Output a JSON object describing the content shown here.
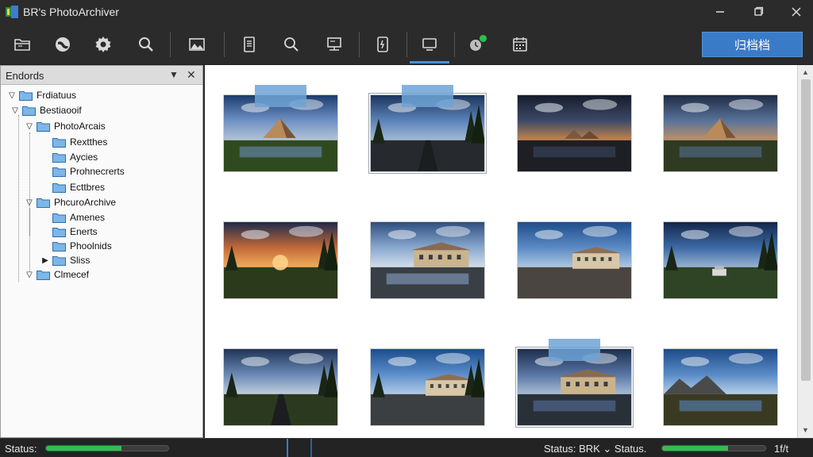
{
  "window": {
    "title": "BR's PhotoArchiver",
    "logo_icon": "photoarchiver-logo-icon",
    "minimize_icon": "minimize-icon",
    "maximize_icon": "maximize-icon",
    "close_icon": "close-icon"
  },
  "toolbar": {
    "buttons": [
      {
        "icon": "open-folder-icon"
      },
      {
        "icon": "globe-icon"
      },
      {
        "icon": "gear-icon"
      },
      {
        "icon": "search-icon"
      },
      {
        "icon": "image-icon"
      },
      {
        "icon": "document-icon"
      },
      {
        "icon": "zoom-icon"
      },
      {
        "icon": "slideshow-icon"
      },
      {
        "icon": "export-icon"
      },
      {
        "icon": "monitor-icon"
      },
      {
        "icon": "sync-status-icon"
      },
      {
        "icon": "calendar-icon"
      }
    ],
    "archive_label": "归档档",
    "accent_color": "#3a7bc8"
  },
  "left_panel": {
    "title": "Endords",
    "filter_icon": "filter-icon",
    "close_icon": "panel-close-icon",
    "tree": [
      {
        "label": "Frdiatuus",
        "expanded": true
      },
      {
        "label": "Bestiaooif",
        "expanded": true
      },
      {
        "label": "PhotoArcais",
        "expanded": true
      },
      {
        "label": "Rextthes"
      },
      {
        "label": "Aycies"
      },
      {
        "label": "Prohnecrerts"
      },
      {
        "label": "Ecttbres"
      },
      {
        "label": "PhcuroArchive",
        "expanded": true
      },
      {
        "label": "Amenes"
      },
      {
        "label": "Enerts"
      },
      {
        "label": "Phoolnids"
      },
      {
        "label": "Sliss",
        "expanded": false
      },
      {
        "label": "Clmecef",
        "expanded": true
      }
    ]
  },
  "gallery": {
    "thumbnails": [
      {
        "scene": "pyramid-sunset-field"
      },
      {
        "scene": "road-car-trees",
        "selected": true
      },
      {
        "scene": "pyramids-dusk-water"
      },
      {
        "scene": "pyramid-reflection-pond"
      },
      {
        "scene": "sunset-burst-field"
      },
      {
        "scene": "building-reflection"
      },
      {
        "scene": "building-cobblestone"
      },
      {
        "scene": "car-meadow-trees"
      },
      {
        "scene": "road-pine-trees"
      },
      {
        "scene": "building-road-trees"
      },
      {
        "scene": "building-waterfront",
        "selected": true
      },
      {
        "scene": "mountain-lake"
      }
    ]
  },
  "statusbar": {
    "left_label": "Status:",
    "left_progress": 0.62,
    "right_label": "Status: BRK ⌄ Status.",
    "right_progress": 0.64,
    "page_indicator": "1f/t",
    "progress_color": "#2fbf4e"
  }
}
